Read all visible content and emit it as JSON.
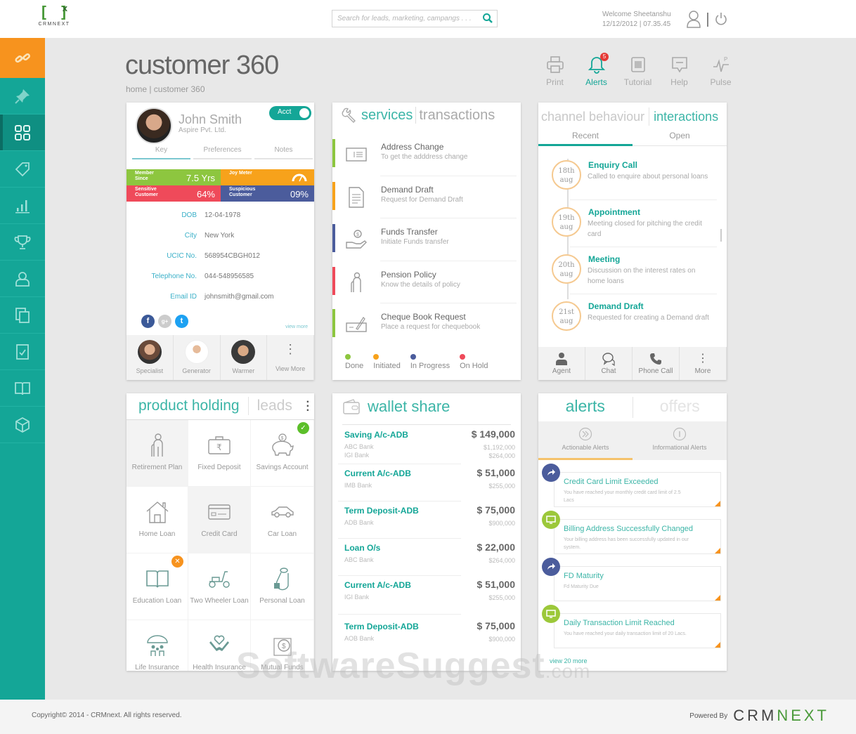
{
  "header": {
    "logo_text": "CRMNEXT",
    "search_placeholder": "Search for leads, marketing, campangs . . .",
    "welcome": "Welcome Sheetanshu",
    "datetime": "12/12/2012 | 07.35.45"
  },
  "sidebar": {
    "items": [
      {
        "icon": "link-icon"
      },
      {
        "icon": "pin-icon"
      },
      {
        "icon": "grid-icon",
        "active": true
      },
      {
        "icon": "tag-icon"
      },
      {
        "icon": "bar-chart-icon"
      },
      {
        "icon": "trophy-icon"
      },
      {
        "icon": "user-icon"
      },
      {
        "icon": "documents-icon"
      },
      {
        "icon": "checklist-icon"
      },
      {
        "icon": "book-icon"
      },
      {
        "icon": "cube-icon"
      }
    ]
  },
  "page": {
    "title": "customer 360",
    "breadcrumb": "home  | customer 360"
  },
  "toolbar": {
    "print": "Print",
    "alerts": "Alerts",
    "alerts_count": "5",
    "tutorial": "Tutorial",
    "help": "Help",
    "pulse": "Pulse"
  },
  "profile": {
    "name": "John Smith",
    "company": "Aspire Pvt. Ltd.",
    "toggle_label": "Acct",
    "tabs": [
      "Key",
      "Preferences",
      "Notes"
    ],
    "stats": [
      {
        "label": "Member Since",
        "value": "7.5 Yrs",
        "color": "#8dc63f"
      },
      {
        "label": "Joy Meter",
        "value": "",
        "color": "#f7a21b"
      },
      {
        "label": "Sensitive Customer",
        "value": "64%",
        "color": "#ef4a5a"
      },
      {
        "label": "Suspicious Customer",
        "value": "09%",
        "color": "#4b5c9c"
      }
    ],
    "details": [
      {
        "key": "DOB",
        "value": "12-04-1978"
      },
      {
        "key": "City",
        "value": "New York"
      },
      {
        "key": "UCIC No.",
        "value": "568954CBGH012"
      },
      {
        "key": "Telephone No.",
        "value": "044-548956585"
      },
      {
        "key": "Email ID",
        "value": "johnsmith@gmail.com"
      }
    ],
    "view_more": "view more",
    "contacts": [
      "Specialist",
      "Generator",
      "Warmer",
      "View More"
    ]
  },
  "services": {
    "title_active": "services",
    "title_inactive": "transactions",
    "items": [
      {
        "title": "Address Change",
        "sub": "To get the adddress change",
        "status_color": "#8dc63f"
      },
      {
        "title": "Demand Draft",
        "sub": "Request for Demand Draft",
        "status_color": "#f7a21b"
      },
      {
        "title": "Funds Transfer",
        "sub": "Initiate Funds transfer",
        "status_color": "#4b5c9c"
      },
      {
        "title": "Pension Policy",
        "sub": "Know the details of policy",
        "status_color": "#ef4a5a"
      },
      {
        "title": "Cheque Book Request",
        "sub": "Place a request for chequebook",
        "status_color": "#8dc63f"
      }
    ],
    "legend": [
      {
        "label": "Done",
        "color": "#8dc63f"
      },
      {
        "label": "Initiated",
        "color": "#f7a21b"
      },
      {
        "label": "In Progress",
        "color": "#4b5c9c"
      },
      {
        "label": "On Hold",
        "color": "#ef4a5a"
      }
    ]
  },
  "interactions": {
    "title_inactive": "channel behaviour",
    "title_active": "interactions",
    "tabs": [
      "Recent",
      "Open"
    ],
    "items": [
      {
        "day": "18th",
        "month": "aug",
        "title": "Enquiry Call",
        "sub": "Called to enquire about personal loans"
      },
      {
        "day": "19th",
        "month": "aug",
        "title": "Appointment",
        "sub": "Meeting closed for pitching the credit card"
      },
      {
        "day": "20th",
        "month": "aug",
        "title": "Meeting",
        "sub": "Discussion on the interest rates on home loans"
      },
      {
        "day": "21st",
        "month": "aug",
        "title": "Demand Draft",
        "sub": "Requested for creating a Demand draft"
      }
    ],
    "footer": [
      "Agent",
      "Chat",
      "Phone Call",
      "More"
    ]
  },
  "products": {
    "title_active": "product holding",
    "title_inactive": "leads",
    "items": [
      {
        "label": "Retirement Plan",
        "shaded": true
      },
      {
        "label": "Fixed Deposit"
      },
      {
        "label": "Savings Account",
        "badge": "check"
      },
      {
        "label": "Home Loan"
      },
      {
        "label": "Credit Card",
        "shaded": true
      },
      {
        "label": "Car Loan"
      },
      {
        "label": "Education Loan",
        "badge": "cross"
      },
      {
        "label": "Two Wheeler Loan"
      },
      {
        "label": "Personal Loan"
      },
      {
        "label": "Life Insurance"
      },
      {
        "label": "Health Insurance"
      },
      {
        "label": "Mutual Funds"
      }
    ]
  },
  "wallet": {
    "title": "wallet share",
    "items": [
      {
        "title": "Saving A/c-ADB",
        "amount": "$ 149,000",
        "banks": [
          "ABC Bank",
          "IGI Bank"
        ],
        "subs": [
          "$1,192,000",
          "$264,000"
        ]
      },
      {
        "title": "Current A/c-ADB",
        "amount": "$ 51,000",
        "banks": [
          "IMB Bank"
        ],
        "subs": [
          "$255,000"
        ]
      },
      {
        "title": "Term Deposit-ADB",
        "amount": "$ 75,000",
        "banks": [
          "ADB Bank"
        ],
        "subs": [
          "$900,000"
        ]
      },
      {
        "title": "Loan O/s",
        "amount": "$ 22,000",
        "banks": [
          "ABC Bank"
        ],
        "subs": [
          "$264,000"
        ]
      },
      {
        "title": "Current A/c-ADB",
        "amount": "$ 51,000",
        "banks": [
          "IGI Bank"
        ],
        "subs": [
          "$255,000"
        ]
      },
      {
        "title": "Term Deposit-ADB",
        "amount": "$ 75,000",
        "banks": [
          "AOB Bank"
        ],
        "subs": [
          "$900,000"
        ]
      }
    ]
  },
  "alerts": {
    "title_active": "alerts",
    "title_inactive": "offers",
    "tabs": [
      "Actionable Alerts",
      "Informational Alerts"
    ],
    "items": [
      {
        "type": "action",
        "title": "Credit Card Limit Exceeded",
        "sub": "You have reached your monthly credit card limit of 2.5 Lacs"
      },
      {
        "type": "info",
        "title": "Billing Address Successfully Changed",
        "sub": "Your billing address has been successfully updated in our system."
      },
      {
        "type": "action",
        "title": "FD Maturity",
        "sub": "Fd Maturity Due"
      },
      {
        "type": "info",
        "title": "Daily Transaction Limit Reached",
        "sub": "You have reached your daily transaction limit of 20 Lacs."
      }
    ],
    "view_more": "view 20 more"
  },
  "colors": {
    "accent": "#14a697",
    "orange": "#f7931e",
    "green": "#8dc63f",
    "blue": "#4b5c9c",
    "red": "#ef4a5a"
  },
  "watermark": {
    "main": "SoftwareSuggest",
    "suffix": ".com"
  },
  "footer": {
    "copyright": "Copyright© 2014 - CRMnext. All rights reserved.",
    "powered_by": "Powered By",
    "brand_a": "CRM",
    "brand_b": "NEXT"
  }
}
